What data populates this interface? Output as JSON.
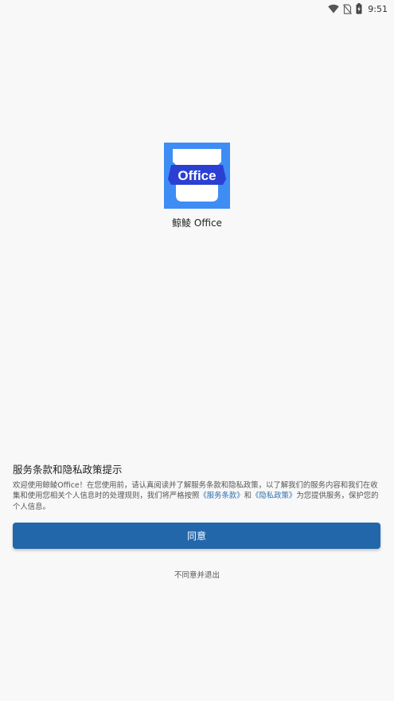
{
  "status_bar": {
    "time": "9:51",
    "icons": [
      "wifi-icon",
      "no-sim-icon",
      "battery-charging-icon"
    ]
  },
  "app": {
    "logo_text": "Office",
    "name": "鲸鲮 Office",
    "colors": {
      "logo_background": "#3d8df5",
      "logo_band": "#2b3fd3"
    }
  },
  "dialog": {
    "title": "服务条款和隐私政策提示",
    "body_intro": "欢迎使用鲸鲮Office！在您使用前，请认真阅读并了解服务条款和隐私政策，以了解我们的服务内容和我们在收集和使用您相关个人信息时的处理规则，我们将严格按照",
    "terms_link": "《服务条款》",
    "body_and": "和",
    "privacy_link": "《隐私政策》",
    "body_outro": "为您提供服务，保护您的个人信息。",
    "agree_label": "同意",
    "disagree_label": "不同意并退出",
    "colors": {
      "primary": "#2367ab",
      "link": "#2f6fb0"
    }
  }
}
